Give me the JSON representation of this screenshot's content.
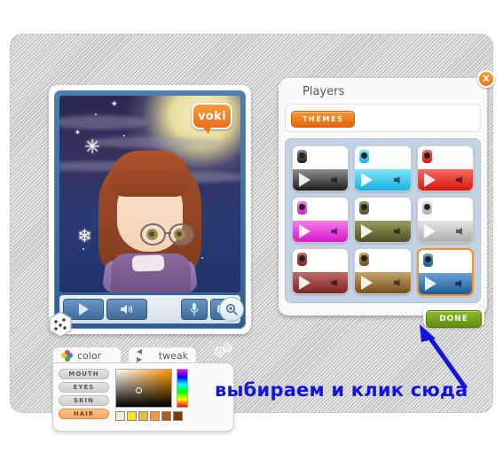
{
  "app": {
    "name": "Voki avatar creator",
    "logo_text": "voki"
  },
  "avatar_preview": {
    "label": "avatar-preview",
    "scene": "winter night sky with moon and snowflakes",
    "character": "girl with auburn bob hair and round glasses",
    "controls": [
      {
        "name": "play-button",
        "icon": "play-icon"
      },
      {
        "name": "volume-button",
        "icon": "speaker-icon"
      },
      {
        "name": "mic-button",
        "icon": "microphone-icon"
      },
      {
        "name": "chat-button",
        "icon": "speech-bubble-icon"
      },
      {
        "name": "zoom-button",
        "icon": "magnifier-plus-icon"
      }
    ],
    "randomize": {
      "name": "dice-button",
      "icon": "dice-icon"
    }
  },
  "players_panel": {
    "title": "Players",
    "close_label": "X",
    "themes_button": "THEMES",
    "done_button": "DONE",
    "themes": [
      {
        "name": "black",
        "color": "#2b2b2b",
        "band_from": "#8f8f8f",
        "band_to": "#1d1d1d",
        "selected": false
      },
      {
        "name": "cyan",
        "color": "#2ec8ef",
        "band_from": "#7fe2f8",
        "band_to": "#16b4e0",
        "selected": false
      },
      {
        "name": "red",
        "color": "#ee2a24",
        "band_from": "#f86a62",
        "band_to": "#d8150f",
        "selected": false
      },
      {
        "name": "magenta",
        "color": "#ea3fe0",
        "band_from": "#f77ced",
        "band_to": "#d518c8",
        "selected": false
      },
      {
        "name": "olive",
        "color": "#6a6c36",
        "band_from": "#9a9c5e",
        "band_to": "#4e5023",
        "selected": false
      },
      {
        "name": "silver",
        "color": "#c8c8c8",
        "band_from": "#e4e4e4",
        "band_to": "#adadad",
        "selected": false
      },
      {
        "name": "dark-red",
        "color": "#9c3a38",
        "band_from": "#c06b68",
        "band_to": "#7c2523",
        "selected": false
      },
      {
        "name": "brown",
        "color": "#9a7135",
        "band_from": "#c8a368",
        "band_to": "#75501d",
        "selected": false
      },
      {
        "name": "blue",
        "color": "#2f6ea8",
        "band_from": "#6aa3d4",
        "band_to": "#1f5a92",
        "selected": true
      }
    ]
  },
  "color_panel": {
    "tabs": [
      {
        "label": "color",
        "icon": "flower-icon",
        "active": true
      },
      {
        "label": "tweak",
        "icon": "prev-next-arrows-icon",
        "active": false
      }
    ],
    "parts": [
      {
        "label": "MOUTH",
        "selected": false
      },
      {
        "label": "EYES",
        "selected": false
      },
      {
        "label": "SKIN",
        "selected": false
      },
      {
        "label": "HAIR",
        "selected": true
      }
    ],
    "swatches": [
      "#f6eecb",
      "#f5e42a",
      "#f4b63e",
      "#ef9a3d",
      "#b85a16",
      "#7a3a10"
    ],
    "settings_icon": "gears-icon"
  },
  "annotation": {
    "text": "выбираем и клик сюда",
    "color": "#1414e0",
    "arrow": "arrow-pointing-to-done-button"
  },
  "colors": {
    "accent_orange": "#e8650d",
    "done_green": "#6f9f1c",
    "selection_border": "#e09445",
    "panel_grid_bg": "#c3d3e6",
    "stage_gray": "#d4d4d4"
  }
}
